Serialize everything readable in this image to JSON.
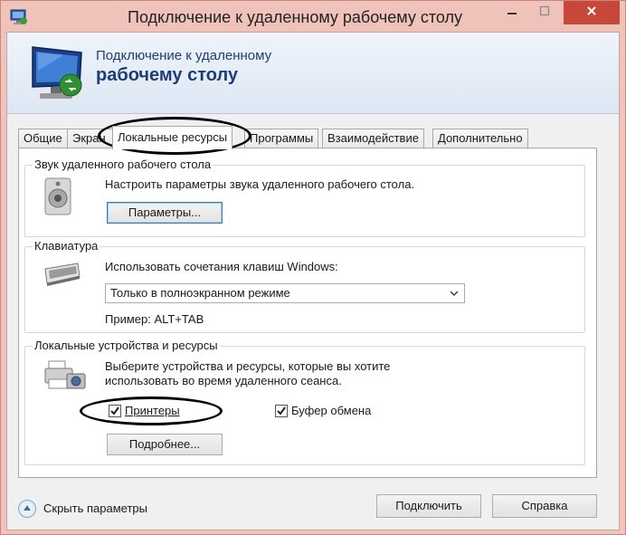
{
  "window": {
    "title": "Подключение к удаленному рабочему столу",
    "close_color": "#c7473b"
  },
  "banner": {
    "line1": "Подключение к удаленному",
    "line2": "рабочему столу"
  },
  "tabs": [
    {
      "label": "Общие"
    },
    {
      "label": "Экран"
    },
    {
      "label": "Локальные ресурсы",
      "active": true
    },
    {
      "label": "Программы"
    },
    {
      "label": "Взаимодействие"
    },
    {
      "label": "Дополнительно"
    }
  ],
  "sound": {
    "legend": "Звук удаленного рабочего стола",
    "description": "Настроить параметры звука удаленного рабочего стола.",
    "button": "Параметры..."
  },
  "keyboard": {
    "legend": "Клавиатура",
    "description": "Использовать сочетания клавиш Windows:",
    "selected_option": "Только в полноэкранном режиме",
    "example": "Пример: ALT+TAB"
  },
  "devices": {
    "legend": "Локальные устройства и ресурсы",
    "description_line1": "Выберите устройства и ресурсы, которые вы хотите",
    "description_line2": "использовать во время удаленного сеанса.",
    "printers_label": "Принтеры",
    "printers_checked": true,
    "clipboard_label": "Буфер обмена",
    "clipboard_checked": true,
    "more_button": "Подробнее..."
  },
  "footer": {
    "toggle_label": "Скрыть параметры",
    "connect_button": "Подключить",
    "help_button": "Справка"
  },
  "icons": {
    "title": "remote-desktop-icon",
    "banner": "remote-desktop-monitor-icon",
    "sound": "speaker-icon",
    "keyboard": "keyboard-icon",
    "devices": "printer-camera-icon",
    "toggle": "collapse-arrow-icon"
  }
}
